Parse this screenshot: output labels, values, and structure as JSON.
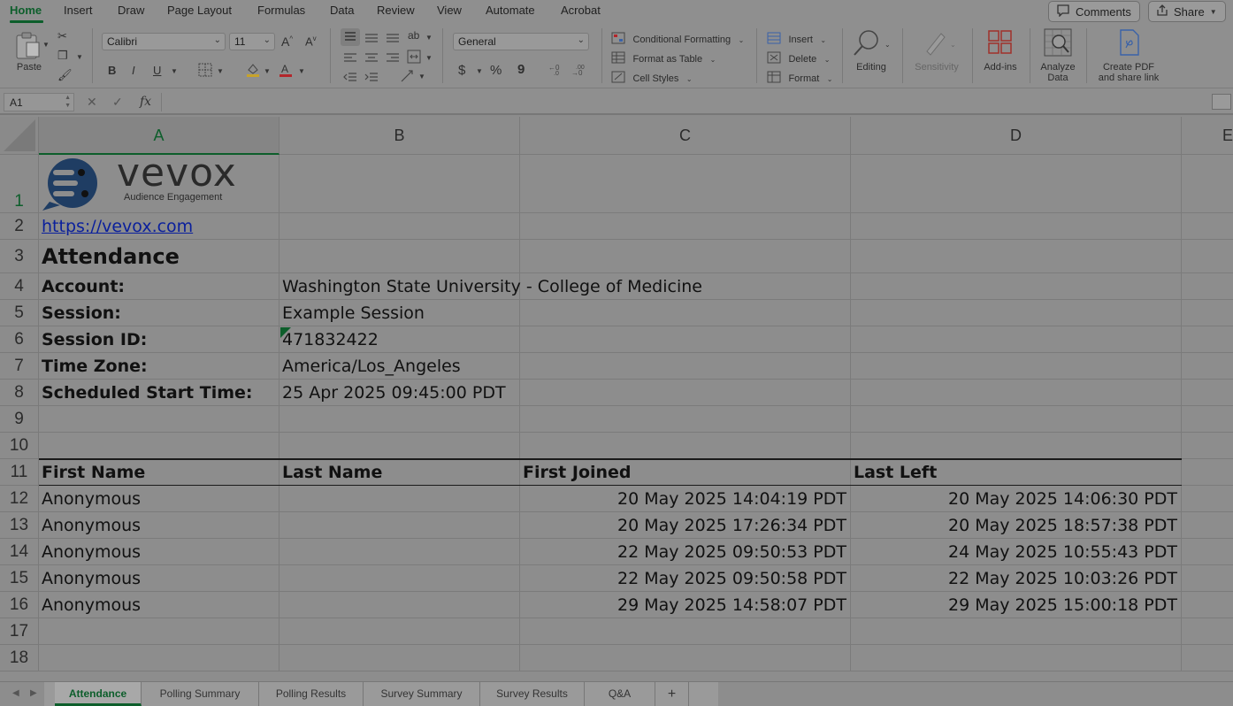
{
  "menu": {
    "tabs": [
      "Home",
      "Insert",
      "Draw",
      "Page Layout",
      "Formulas",
      "Data",
      "Review",
      "View",
      "Automate",
      "Acrobat"
    ],
    "active_tab": "Home",
    "comments_label": "Comments",
    "share_label": "Share"
  },
  "ribbon": {
    "paste_label": "Paste",
    "font_name": "Calibri",
    "font_size": "11",
    "number_format": "General",
    "conditional_formatting": "Conditional Formatting",
    "format_as_table": "Format as Table",
    "cell_styles": "Cell Styles",
    "insert_label": "Insert",
    "delete_label": "Delete",
    "format_label": "Format",
    "editing_label": "Editing",
    "sensitivity_label": "Sensitivity",
    "addins_label": "Add-ins",
    "analyze_label_1": "Analyze",
    "analyze_label_2": "Data",
    "createpdf_label_1": "Create PDF",
    "createpdf_label_2": "and share link",
    "bold": "B",
    "italic": "I",
    "underline": "U",
    "currency": "$",
    "percent": "%",
    "comma": "9",
    "grow_font": "A",
    "shrink_font": "A"
  },
  "formula_bar": {
    "name_box": "A1",
    "fx": "fx",
    "formula": ""
  },
  "sheet": {
    "columns": [
      "A",
      "B",
      "C",
      "D",
      "E"
    ],
    "selected_column": "A",
    "rows": [
      "1",
      "2",
      "3",
      "4",
      "5",
      "6",
      "7",
      "8",
      "9",
      "10",
      "11",
      "12",
      "13",
      "14",
      "15",
      "16",
      "17",
      "18"
    ],
    "logo_text": "vevox",
    "logo_tagline": "Audience Engagement",
    "link": "https://vevox.com",
    "title": "Attendance",
    "info": [
      {
        "label": "Account:",
        "value": "Washington State University - College of Medicine"
      },
      {
        "label": "Session:",
        "value": "Example Session"
      },
      {
        "label": "Session ID:",
        "value": "471832422"
      },
      {
        "label": "Time Zone:",
        "value": "America/Los_Angeles"
      },
      {
        "label": "Scheduled Start Time:",
        "value": "25 Apr 2025 09:45:00 PDT"
      }
    ],
    "table_headers": [
      "First Name",
      "Last Name",
      "First Joined",
      "Last Left"
    ],
    "table_rows": [
      {
        "first": "Anonymous",
        "last": "",
        "joined": "20 May 2025 14:04:19 PDT",
        "left": "20 May 2025 14:06:30 PDT"
      },
      {
        "first": "Anonymous",
        "last": "",
        "joined": "20 May 2025 17:26:34 PDT",
        "left": "20 May 2025 18:57:38 PDT"
      },
      {
        "first": "Anonymous",
        "last": "",
        "joined": "22 May 2025 09:50:53 PDT",
        "left": "24 May 2025 10:55:43 PDT"
      },
      {
        "first": "Anonymous",
        "last": "",
        "joined": "22 May 2025 09:50:58 PDT",
        "left": "22 May 2025 10:03:26 PDT"
      },
      {
        "first": "Anonymous",
        "last": "",
        "joined": "29 May 2025 14:58:07 PDT",
        "left": "29 May 2025 15:00:18 PDT"
      }
    ]
  },
  "sheet_tabs": {
    "tabs": [
      "Attendance",
      "Polling Summary",
      "Polling Results",
      "Survey Summary",
      "Survey Results",
      "Q&A"
    ],
    "active": "Attendance",
    "add_label": "+"
  },
  "colors": {
    "excel_green": "#0d5e2b",
    "link_blue": "#0a1f9c",
    "overlay_gray": "#8d8d8d"
  }
}
